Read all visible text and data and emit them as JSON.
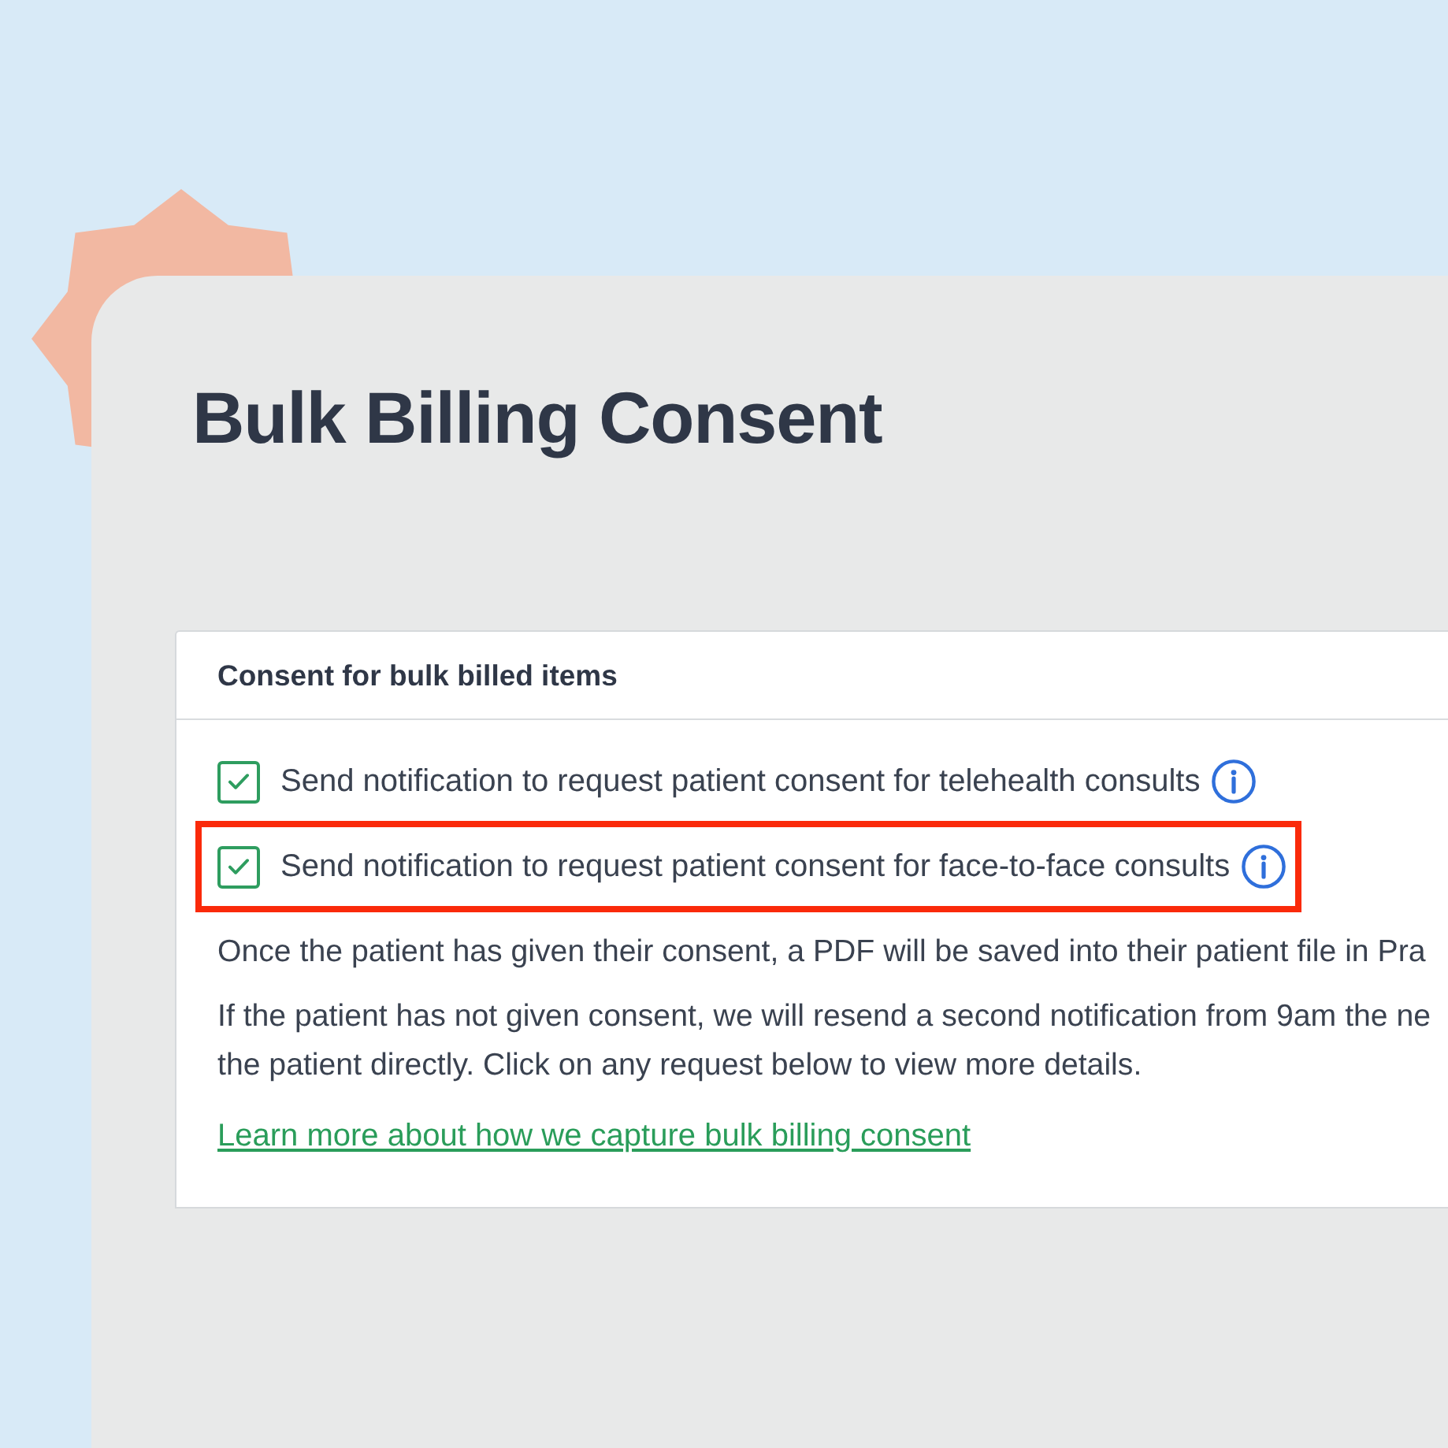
{
  "page": {
    "title": "Bulk Billing Consent"
  },
  "card": {
    "heading": "Consent for bulk billed items",
    "options": [
      {
        "label": "Send notification to request patient consent for telehealth consults",
        "checked": true,
        "highlighted": false
      },
      {
        "label": "Send notification to request patient consent for face-to-face consults",
        "checked": true,
        "highlighted": true
      }
    ],
    "paragraphs": [
      {
        "lines": [
          "Once the patient has given their consent, a PDF will be saved into their patient file in Pra"
        ]
      },
      {
        "lines": [
          "If the patient has not given consent, we will resend a second notification from 9am the ne",
          "the patient directly. Click on any request below to view more details."
        ]
      }
    ],
    "link": "Learn more about how we capture bulk billing consent"
  }
}
